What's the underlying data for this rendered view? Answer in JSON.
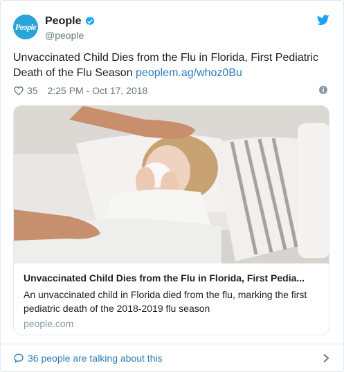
{
  "author": {
    "avatar_text": "People",
    "display_name": "People",
    "handle": "@people"
  },
  "tweet": {
    "text": "Unvaccinated Child Dies from the Flu in Florida, First Pediatric Death of the Flu Season",
    "link": "peoplem.ag/whoz0Bu",
    "likes": "35",
    "timestamp": "2:25 PM - Oct 17, 2018"
  },
  "card": {
    "title": "Unvaccinated Child Dies from the Flu in Florida, First Pedia...",
    "description": "An unvaccinated child in Florida died from the flu, marking the first pediatric death of the 2018-2019 flu season",
    "domain": "people.com"
  },
  "footer": {
    "talking": "36 people are talking about this"
  },
  "colors": {
    "link": "#2b7bb9",
    "verified": "#1da1f2",
    "avatar_bg": "#2aa3d9",
    "muted": "#697882"
  },
  "icons": [
    "verified-badge-icon",
    "twitter-bird-icon",
    "heart-icon",
    "info-icon",
    "speech-bubble-icon",
    "chevron-right-icon"
  ]
}
